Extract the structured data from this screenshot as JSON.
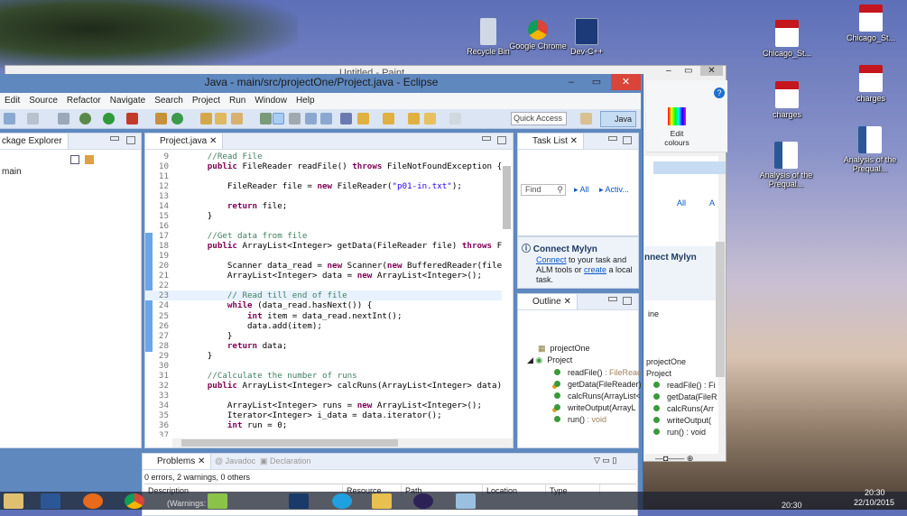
{
  "desktop": {
    "icons": [
      {
        "label": "Recycle Bin"
      },
      {
        "label": "Google Chrome"
      },
      {
        "label": "Dev-C++"
      },
      {
        "label": "Chicago_St..."
      },
      {
        "label": "charges"
      },
      {
        "label": "Analysis of the Prequal..."
      },
      {
        "label": "Chicago_St..."
      },
      {
        "label": "charges"
      },
      {
        "label": "Analysis of the Prequal..."
      }
    ]
  },
  "paint": {
    "title": "Untitled - Paint",
    "edit_colours": "Edit colours",
    "connect_mylyn": "nnect Mylyn",
    "outline_tab": "ine",
    "items": [
      "projectOne",
      "Project",
      "readFile() : Fi",
      "getData(FileR",
      "calcRuns(Arr",
      "writeOutput(",
      "run() : void"
    ],
    "links": [
      "All",
      "A"
    ]
  },
  "eclipse": {
    "title": "Java - main/src/projectOne/Project.java - Eclipse",
    "menu": [
      "Edit",
      "Source",
      "Refactor",
      "Navigate",
      "Search",
      "Project",
      "Run",
      "Window",
      "Help"
    ],
    "quick_access": "Quick Access",
    "perspective": "Java",
    "package_explorer": {
      "tab": "ckage Explorer",
      "items": [
        "main"
      ]
    },
    "editor": {
      "tab": "Project.java",
      "lines": [
        [
          9,
          [
            [
              "    ",
              "tx"
            ],
            [
              "//Read File",
              "cm"
            ]
          ]
        ],
        [
          10,
          [
            [
              "    ",
              "tx"
            ],
            [
              "public",
              "kw"
            ],
            [
              " FileReader readFile() ",
              "tx"
            ],
            [
              "throws",
              "kw"
            ],
            [
              " FileNotFoundException {",
              "tx"
            ]
          ]
        ],
        [
          11,
          []
        ],
        [
          12,
          [
            [
              "        FileReader file = ",
              "tx"
            ],
            [
              "new",
              "kw"
            ],
            [
              " FileReader(",
              "tx"
            ],
            [
              "\"p01-in.txt\"",
              "st"
            ],
            [
              ");",
              "tx"
            ]
          ]
        ],
        [
          13,
          []
        ],
        [
          14,
          [
            [
              "        ",
              "tx"
            ],
            [
              "return",
              "kw"
            ],
            [
              " file;",
              "tx"
            ]
          ]
        ],
        [
          15,
          [
            [
              "    }",
              "tx"
            ]
          ]
        ],
        [
          16,
          []
        ],
        [
          17,
          [
            [
              "    ",
              "tx"
            ],
            [
              "//Get data from file",
              "cm"
            ]
          ]
        ],
        [
          18,
          [
            [
              "    ",
              "tx"
            ],
            [
              "public",
              "kw"
            ],
            [
              " ArrayList<Integer> getData(FileReader file) ",
              "tx"
            ],
            [
              "throws",
              "kw"
            ],
            [
              " FileNot",
              "tx"
            ]
          ]
        ],
        [
          19,
          []
        ],
        [
          20,
          [
            [
              "        Scanner data_read = ",
              "tx"
            ],
            [
              "new",
              "kw"
            ],
            [
              " Scanner(",
              "tx"
            ],
            [
              "new",
              "kw"
            ],
            [
              " BufferedReader(file));",
              "tx"
            ]
          ]
        ],
        [
          21,
          [
            [
              "        ArrayList<Integer> data = ",
              "tx"
            ],
            [
              "new",
              "kw"
            ],
            [
              " ArrayList<Integer>();",
              "tx"
            ]
          ]
        ],
        [
          22,
          []
        ],
        [
          23,
          [
            [
              "        ",
              "tx"
            ],
            [
              "// Read till end of file",
              "cm"
            ]
          ]
        ],
        [
          24,
          [
            [
              "        ",
              "tx"
            ],
            [
              "while",
              "kw"
            ],
            [
              " (data_read.hasNext()) {",
              "tx"
            ]
          ]
        ],
        [
          25,
          [
            [
              "            ",
              "tx"
            ],
            [
              "int",
              "kw"
            ],
            [
              " item = data_read.nextInt();",
              "tx"
            ]
          ]
        ],
        [
          26,
          [
            [
              "            data.add(item);",
              "tx"
            ]
          ]
        ],
        [
          27,
          [
            [
              "        }",
              "tx"
            ]
          ]
        ],
        [
          28,
          [
            [
              "        ",
              "tx"
            ],
            [
              "return",
              "kw"
            ],
            [
              " data;",
              "tx"
            ]
          ]
        ],
        [
          29,
          [
            [
              "    }",
              "tx"
            ]
          ]
        ],
        [
          30,
          []
        ],
        [
          31,
          [
            [
              "    ",
              "tx"
            ],
            [
              "//Calculate the number of runs",
              "cm"
            ]
          ]
        ],
        [
          32,
          [
            [
              "    ",
              "tx"
            ],
            [
              "public",
              "kw"
            ],
            [
              " ArrayList<Integer> calcRuns(ArrayList<Integer> data) {",
              "tx"
            ]
          ]
        ],
        [
          33,
          []
        ],
        [
          34,
          [
            [
              "        ArrayList<Integer> runs = ",
              "tx"
            ],
            [
              "new",
              "kw"
            ],
            [
              " ArrayList<Integer>();",
              "tx"
            ]
          ]
        ],
        [
          35,
          [
            [
              "        Iterator<Integer> i_data = data.iterator();",
              "tx"
            ]
          ]
        ],
        [
          36,
          [
            [
              "        ",
              "tx"
            ],
            [
              "int",
              "kw"
            ],
            [
              " run = 0;",
              "tx"
            ]
          ]
        ],
        [
          37,
          []
        ]
      ]
    },
    "task_list": {
      "tab": "Task List",
      "find_placeholder": "Find",
      "links": [
        "All",
        "Activ..."
      ]
    },
    "mylyn": {
      "title": "Connect Mylyn",
      "connect": "Connect",
      "text1": " to your task and ALM tools or ",
      "create": "create",
      "text2": " a local task."
    },
    "outline": {
      "tab": "Outline",
      "package": "projectOne",
      "class": "Project",
      "members": [
        {
          "name": "readFile()",
          "type": " : FileReac",
          "warn": false
        },
        {
          "name": "getData(FileReader)",
          "type": "",
          "warn": true
        },
        {
          "name": "calcRuns(ArrayList<",
          "type": "",
          "warn": false
        },
        {
          "name": "writeOutput(ArrayL",
          "type": "",
          "warn": true
        },
        {
          "name": "run()",
          "type": " : void",
          "warn": false
        }
      ]
    },
    "problems": {
      "tabs": [
        "Problems",
        "Javadoc",
        "Declaration"
      ],
      "summary": "0 errors, 2 warnings, 0 others",
      "columns": [
        "Description",
        "Resource",
        "Path",
        "Location",
        "Type"
      ]
    }
  },
  "taskbar": {
    "item_label": "(Warnings: ms)",
    "clock_time": "20:30",
    "clock_date": "22/10/2015",
    "clock_time2": "20:30"
  }
}
